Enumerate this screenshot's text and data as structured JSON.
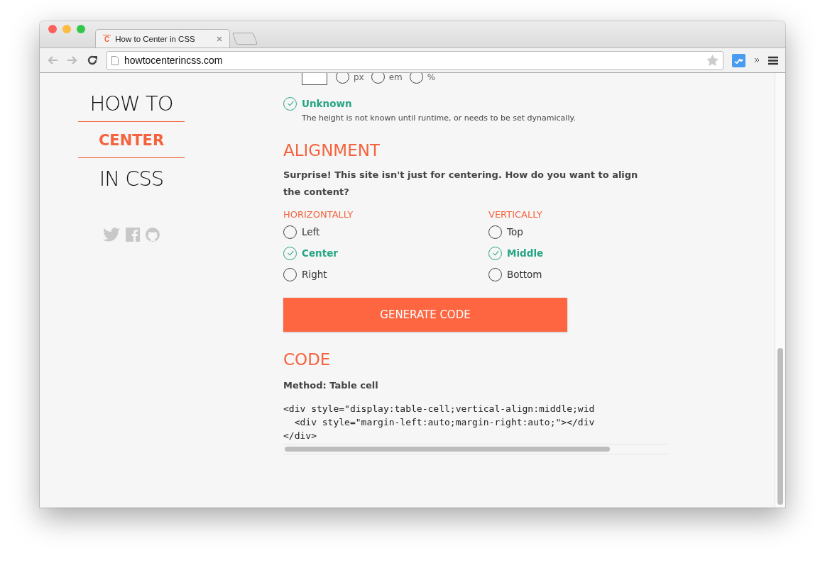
{
  "browser": {
    "tab_title": "How to Center in CSS",
    "favicon_letter": "C",
    "url": "howtocenterincss.com"
  },
  "sidebar": {
    "logo_top": "HOW TO",
    "logo_middle": "CENTER",
    "logo_bottom": "IN CSS"
  },
  "height_units": [
    {
      "label": "px",
      "selected": false
    },
    {
      "label": "em",
      "selected": false
    },
    {
      "label": "%",
      "selected": false
    }
  ],
  "height_option": {
    "label": "Unknown",
    "selected": true,
    "description": "The height is not known until runtime, or needs to be set dynamically."
  },
  "alignment": {
    "heading": "ALIGNMENT",
    "intro": "Surprise! This site isn't just for centering. How do you want to align the content?",
    "groups": [
      {
        "heading": "HORIZONTALLY",
        "options": [
          {
            "label": "Left",
            "selected": false
          },
          {
            "label": "Center",
            "selected": true
          },
          {
            "label": "Right",
            "selected": false
          }
        ]
      },
      {
        "heading": "VERTICALLY",
        "options": [
          {
            "label": "Top",
            "selected": false
          },
          {
            "label": "Middle",
            "selected": true
          },
          {
            "label": "Bottom",
            "selected": false
          }
        ]
      }
    ]
  },
  "generate_button": "GENERATE CODE",
  "code": {
    "heading": "CODE",
    "method": "Method: Table cell",
    "lines": [
      "<div style=\"display:table-cell;vertical-align:middle;wid",
      "  <div style=\"margin-left:auto;margin-right:auto;\"></div",
      "</div>"
    ]
  }
}
